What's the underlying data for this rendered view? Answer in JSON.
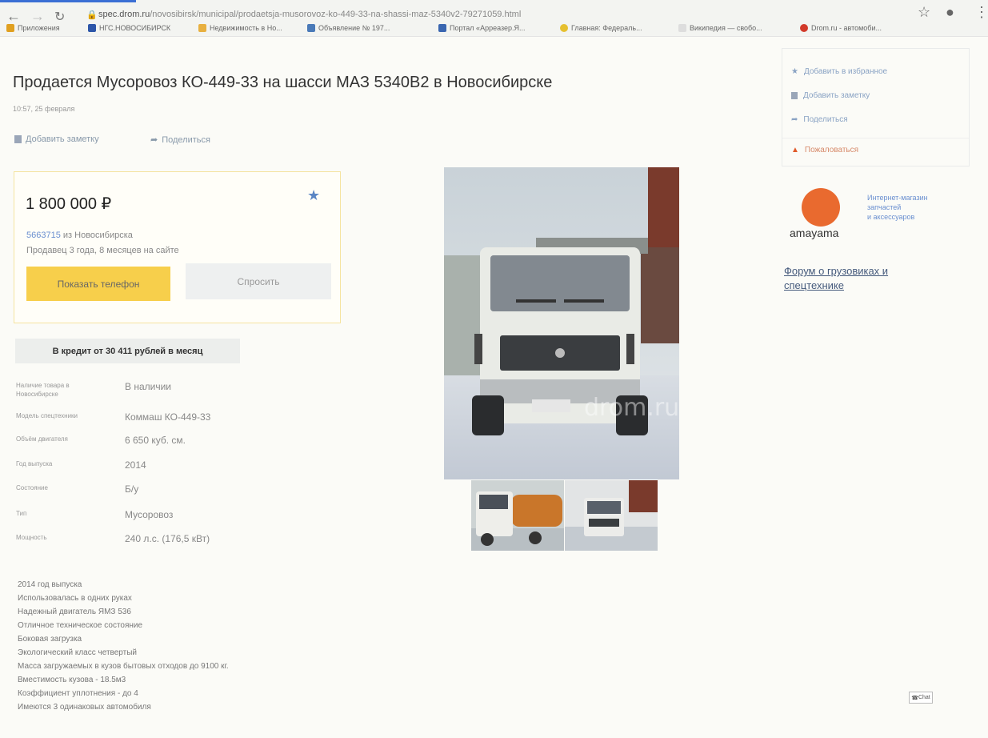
{
  "browser": {
    "url_host": "spec.drom.ru",
    "url_path": "/novosibirsk/municipal/prodaetsja-musorovoz-ko-449-33-na-shassi-maz-5340v2-79271059.html",
    "bookmarks": [
      "Приложения",
      "НГС.НОВОСИБИРСК",
      "Недвижимость в Но...",
      "Объявление № 197...",
      "Портал «Арреазер.Я...",
      "Главная: Федераль...",
      "Википедия — свобо...",
      "Drom.ru - автомоби..."
    ]
  },
  "header": {
    "title": "Продается Мусоровоз КО-449-33 на шасси МАЗ 5340В2 в Новосибирске",
    "date": "10:57, 25 февраля",
    "add_note": "Добавить заметку",
    "share": "Поделиться"
  },
  "price_block": {
    "price": "1 800 000 ₽",
    "seller_id": "5663715",
    "seller_city": " из Новосибирска",
    "since": "Продавец 3 года, 8 месяцев на сайте",
    "show_phone": "Показать телефон",
    "ask": "Спросить"
  },
  "credit": "В кредит от 30 411 рублей в месяц",
  "specs": [
    {
      "key": "Наличие товара в Новосибирске",
      "value": "В наличии"
    },
    {
      "key": "Модель спецтехники",
      "value": "Коммаш КО-449-33"
    },
    {
      "key": "Объём двигателя",
      "value": "6 650 куб. см."
    },
    {
      "key": "Год выпуска",
      "value": "2014"
    },
    {
      "key": "Состояние",
      "value": "Б/у"
    },
    {
      "key": "Тип",
      "value": "Мусоровоз"
    },
    {
      "key": "Мощность",
      "value": "240 л.с. (176,5 кВт)"
    }
  ],
  "description": [
    "2014 год выпуска",
    "Использовалась в одних руках",
    "Надежный двигатель ЯМЗ 536",
    "Отличное техническое состояние",
    "Боковая загрузка",
    "Экологический класс четвертый",
    "Масса загружаемых в кузов бытовых отходов до 9100 кг.",
    "Вместимость кузова - 18.5м3",
    "Коэффициент уплотнения - до 4",
    "Имеются 3 одинаковых автомобиля"
  ],
  "sidebar": {
    "items": [
      "Добавить в избранное",
      "Добавить заметку",
      "Поделиться",
      "Пожаловаться"
    ],
    "ad_brand": "amayama",
    "ad_text": [
      "Интернет-магазин",
      "запчастей",
      "и аксессуаров"
    ],
    "forum": [
      "Форум о грузовиках и",
      "спецтехнике"
    ]
  },
  "photo_watermark": "drom.ru",
  "chat_label": "Chat",
  "colors": {
    "accent_yellow": "#f7cf4b",
    "link_blue": "#6a8fd0",
    "warning_orange": "#e96a2f"
  }
}
